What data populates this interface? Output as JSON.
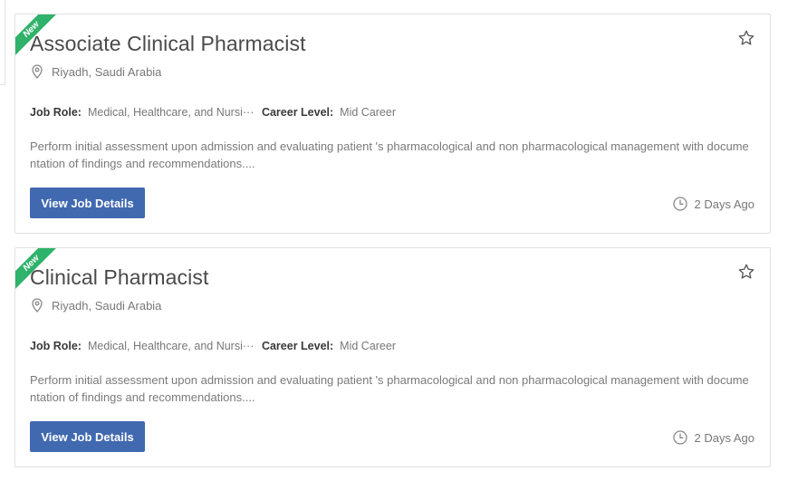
{
  "jobs": [
    {
      "badge": "New",
      "title": "Associate Clinical Pharmacist",
      "location": "Riyadh, Saudi Arabia",
      "job_role_label": "Job Role:",
      "job_role_value": "Medical, Healthcare, and Nursi···",
      "career_level_label": "Career Level:",
      "career_level_value": "Mid Career",
      "description": "Perform initial assessment upon admission and evaluating patient 's pharmacological and non pharmacological management with documentation of findings and recommendations....",
      "button_label": "View Job Details",
      "posted": "2 Days Ago"
    },
    {
      "badge": "New",
      "title": "Clinical Pharmacist",
      "location": "Riyadh, Saudi Arabia",
      "job_role_label": "Job Role:",
      "job_role_value": "Medical, Healthcare, and Nursi···",
      "career_level_label": "Career Level:",
      "career_level_value": "Mid Career",
      "description": "Perform initial assessment upon admission and evaluating patient 's pharmacological and non pharmacological management with documentation of findings and recommendations....",
      "button_label": "View Job Details",
      "posted": "2 Days Ago"
    }
  ],
  "icons": {
    "favorite": "star-outline-icon",
    "location": "map-pin-icon",
    "time": "clock-icon"
  },
  "colors": {
    "badge": "#2fb26a",
    "button": "#4169b0"
  }
}
